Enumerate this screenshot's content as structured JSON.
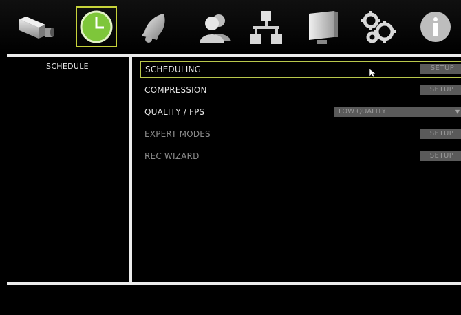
{
  "toolbar": {
    "icons": [
      {
        "name": "camera-icon",
        "active": false
      },
      {
        "name": "clock-icon",
        "active": true
      },
      {
        "name": "bell-icon",
        "active": false
      },
      {
        "name": "users-icon",
        "active": false
      },
      {
        "name": "network-icon",
        "active": false
      },
      {
        "name": "monitor-icon",
        "active": false
      },
      {
        "name": "gears-icon",
        "active": false
      },
      {
        "name": "info-icon",
        "active": false
      }
    ],
    "accent_color": "#c6d23a"
  },
  "sidebar": {
    "title": "SCHEDULE"
  },
  "menu": {
    "items": [
      {
        "label": "SCHEDULING",
        "control": "button",
        "button_label": "SETUP",
        "selected": true,
        "enabled": true
      },
      {
        "label": "COMPRESSION",
        "control": "button",
        "button_label": "SETUP",
        "selected": false,
        "enabled": true
      },
      {
        "label": "QUALITY / FPS",
        "control": "dropdown",
        "value": "LOW QUALITY",
        "selected": false,
        "enabled": true
      },
      {
        "label": "EXPERT MODES",
        "control": "button",
        "button_label": "SETUP",
        "selected": false,
        "enabled": false
      },
      {
        "label": "REC WIZARD",
        "control": "button",
        "button_label": "SETUP",
        "selected": false,
        "enabled": false
      }
    ]
  }
}
